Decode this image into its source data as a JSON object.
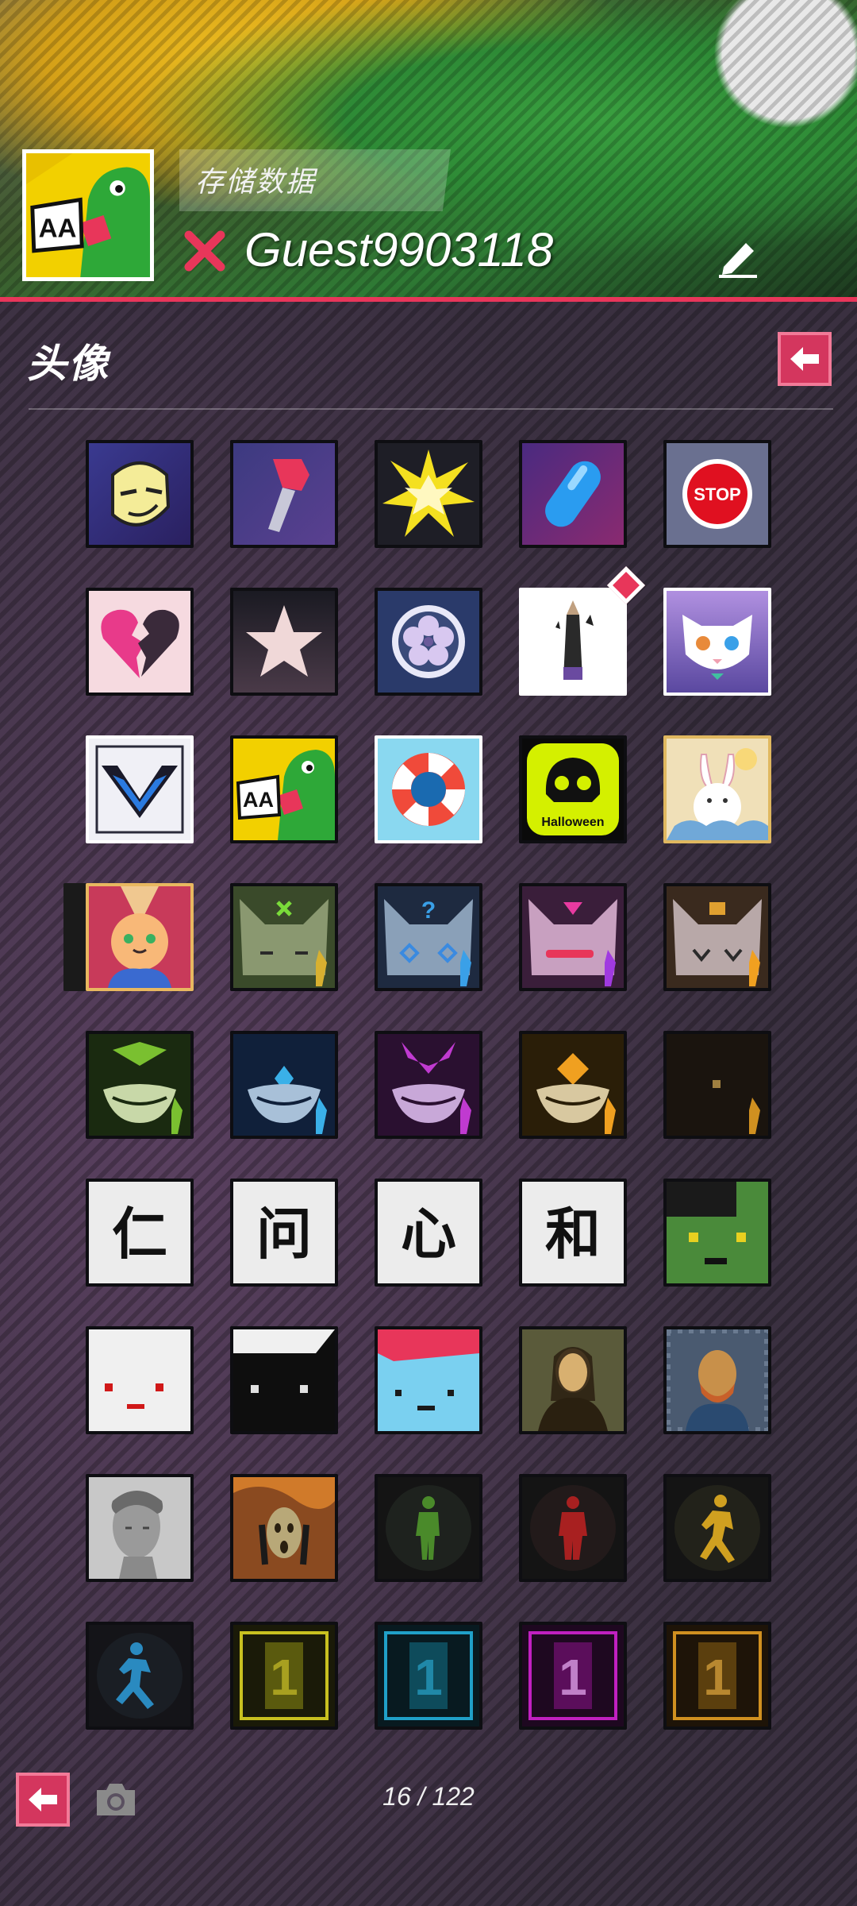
{
  "header": {
    "save_label": "存储数据",
    "username": "Guest9903118",
    "avatar_icon": "dinosaur-aa-icon",
    "accent_color": "#e8365a"
  },
  "section": {
    "title": "头像"
  },
  "avatars": [
    {
      "icon": "moon-face-icon"
    },
    {
      "icon": "pipe-icon"
    },
    {
      "icon": "explosion-icon"
    },
    {
      "icon": "capsule-pill-icon"
    },
    {
      "icon": "stop-sign-icon"
    },
    {
      "icon": "broken-heart-icon"
    },
    {
      "icon": "star-icon"
    },
    {
      "icon": "flower-crest-icon"
    },
    {
      "icon": "pencil-icon",
      "new": true
    },
    {
      "icon": "white-cat-icon"
    },
    {
      "icon": "chevron-logo-icon"
    },
    {
      "icon": "dinosaur-aa-icon"
    },
    {
      "icon": "lifebuoy-icon"
    },
    {
      "icon": "halloween-skull-icon",
      "label": "Halloween"
    },
    {
      "icon": "moon-rabbit-icon"
    },
    {
      "icon": "bunny-character-icon",
      "selected": true
    },
    {
      "icon": "green-cat-mask-icon"
    },
    {
      "icon": "blue-cat-mask-icon"
    },
    {
      "icon": "pink-cat-mask-icon"
    },
    {
      "icon": "orange-cat-mask-icon"
    },
    {
      "icon": "green-grin-mask-icon"
    },
    {
      "icon": "blue-grin-mask-icon"
    },
    {
      "icon": "purple-grin-mask-icon"
    },
    {
      "icon": "orange-grin-mask-icon"
    },
    {
      "icon": "dark-mask-icon"
    },
    {
      "icon": "kanji-ren-icon",
      "label": "仁"
    },
    {
      "icon": "kanji-wen-icon",
      "label": "问"
    },
    {
      "icon": "kanji-xin-icon",
      "label": "心"
    },
    {
      "icon": "kanji-he-icon",
      "label": "和"
    },
    {
      "icon": "green-pixel-face-icon"
    },
    {
      "icon": "white-pixel-face-icon"
    },
    {
      "icon": "black-pixel-face-icon"
    },
    {
      "icon": "blue-pixel-face-icon"
    },
    {
      "icon": "mona-lisa-icon"
    },
    {
      "icon": "van-gogh-icon"
    },
    {
      "icon": "david-statue-icon"
    },
    {
      "icon": "the-scream-icon"
    },
    {
      "icon": "green-walk-signal-icon"
    },
    {
      "icon": "red-stop-signal-icon"
    },
    {
      "icon": "yellow-running-signal-icon"
    },
    {
      "icon": "blue-running-signal-icon"
    },
    {
      "icon": "yellow-rank-one-icon",
      "label": "1"
    },
    {
      "icon": "blue-rank-one-icon",
      "label": "1"
    },
    {
      "icon": "purple-rank-one-icon",
      "label": "1"
    },
    {
      "icon": "orange-rank-one-icon",
      "label": "1"
    }
  ],
  "footer": {
    "page_indicator": "16 / 122"
  }
}
